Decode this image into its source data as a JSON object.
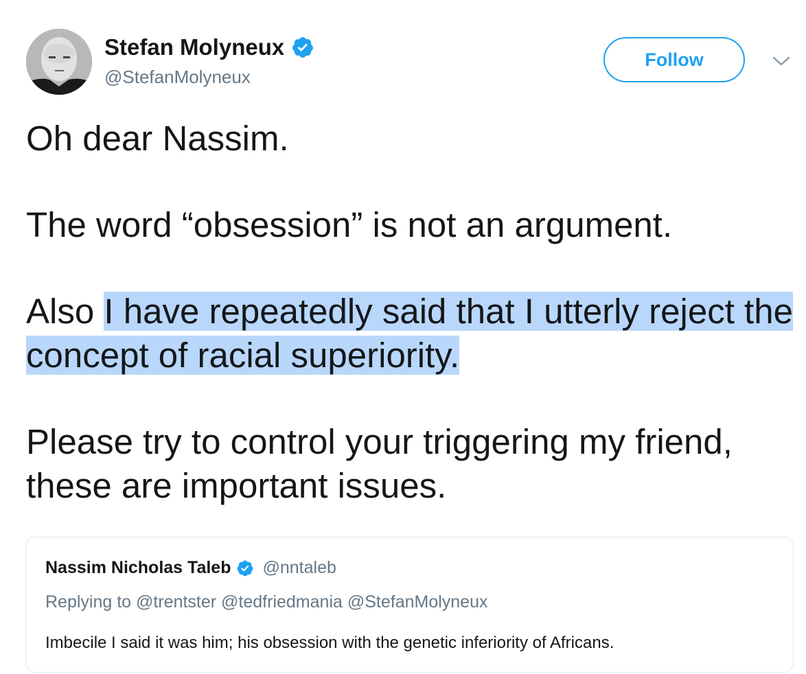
{
  "author": {
    "display_name": "Stefan Molyneux",
    "handle": "@StefanMolyneux",
    "verified": true
  },
  "actions": {
    "follow_label": "Follow"
  },
  "tweet": {
    "para1": "Oh dear Nassim.",
    "para2": "The word “obsession” is not an argument.",
    "para3_prefix": "Also ",
    "para3_highlighted": "I have repeatedly said that I utterly reject the concept of racial superiority.",
    "para4": "Please try to control your triggering my friend, these are important issues."
  },
  "quoted_tweet": {
    "display_name": "Nassim Nicholas Taleb",
    "handle": "@nntaleb",
    "verified": true,
    "replying_to": "Replying to @trentster @tedfriedmania @StefanMolyneux",
    "text": "Imbecile I said it was him; his obsession with the genetic inferiority of Africans."
  },
  "colors": {
    "brand_blue": "#1da1f2",
    "secondary_text": "#657786",
    "selection_highlight": "#b9d7fb",
    "border": "#e1e8ed"
  },
  "icons": {
    "verified": "verified-badge-icon",
    "menu": "chevron-down-icon"
  }
}
